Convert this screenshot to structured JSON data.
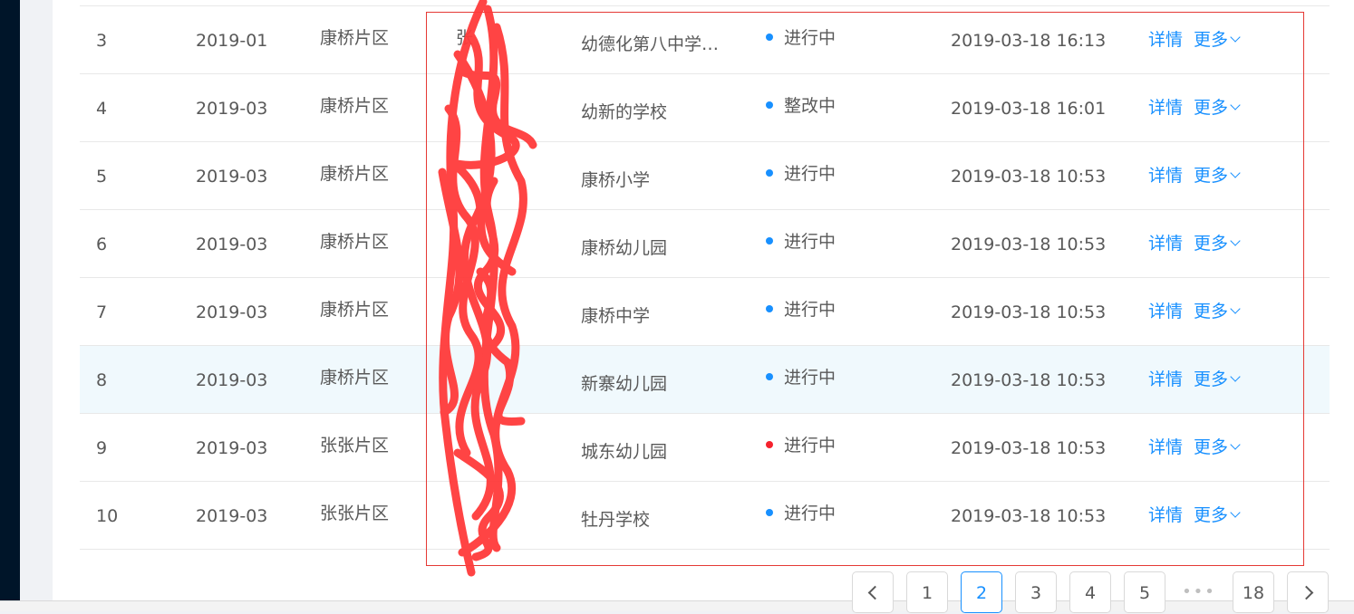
{
  "colors": {
    "accent": "#1890ff",
    "status_processing": "#1890ff",
    "status_error": "#f5222d",
    "annotation_box": "#e53935",
    "scribble": "#ff3b3b"
  },
  "rows": [
    {
      "no": "3",
      "month": "2019-01",
      "area": "康桥片区",
      "person": "张",
      "school": "幼德化第八中学…",
      "status": "进行中",
      "status_color": "#1890ff",
      "time": "2019-03-18 16:13",
      "detail": "详情",
      "more": "更多"
    },
    {
      "no": "4",
      "month": "2019-03",
      "area": "康桥片区",
      "person": "",
      "school": "幼新的学校",
      "status": "整改中",
      "status_color": "#1890ff",
      "time": "2019-03-18 16:01",
      "detail": "详情",
      "more": "更多"
    },
    {
      "no": "5",
      "month": "2019-03",
      "area": "康桥片区",
      "person": "",
      "school": "康桥小学",
      "status": "进行中",
      "status_color": "#1890ff",
      "time": "2019-03-18 10:53",
      "detail": "详情",
      "more": "更多"
    },
    {
      "no": "6",
      "month": "2019-03",
      "area": "康桥片区",
      "person": "",
      "school": "康桥幼儿园",
      "status": "进行中",
      "status_color": "#1890ff",
      "time": "2019-03-18 10:53",
      "detail": "详情",
      "more": "更多"
    },
    {
      "no": "7",
      "month": "2019-03",
      "area": "康桥片区",
      "person": "",
      "school": "康桥中学",
      "status": "进行中",
      "status_color": "#1890ff",
      "time": "2019-03-18 10:53",
      "detail": "详情",
      "more": "更多"
    },
    {
      "no": "8",
      "month": "2019-03",
      "area": "康桥片区",
      "person": "",
      "school": "新寨幼儿园",
      "status": "进行中",
      "status_color": "#1890ff",
      "time": "2019-03-18 10:53",
      "detail": "详情",
      "more": "更多"
    },
    {
      "no": "9",
      "month": "2019-03",
      "area": "张张片区",
      "person": "",
      "school": "城东幼儿园",
      "status": "进行中",
      "status_color": "#f5222d",
      "time": "2019-03-18 10:53",
      "detail": "详情",
      "more": "更多"
    },
    {
      "no": "10",
      "month": "2019-03",
      "area": "张张片区",
      "person": "",
      "school": "牡丹学校",
      "status": "进行中",
      "status_color": "#1890ff",
      "time": "2019-03-18 10:53",
      "detail": "详情",
      "more": "更多"
    }
  ],
  "pagination": {
    "prev_icon": "chevron-left-icon",
    "next_icon": "chevron-right-icon",
    "pages": [
      "1",
      "2",
      "3",
      "4",
      "5"
    ],
    "current": "2",
    "ellipsis": "•••",
    "last": "18"
  }
}
